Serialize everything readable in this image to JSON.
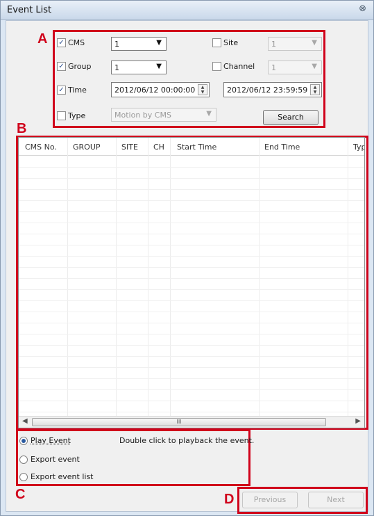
{
  "window": {
    "title": "Event List",
    "close_glyph": "⊗"
  },
  "markers": {
    "a": "A",
    "b": "B",
    "c": "C",
    "d": "D"
  },
  "filters": {
    "cms": {
      "label": "CMS",
      "checked": true,
      "value": "1"
    },
    "group": {
      "label": "Group",
      "checked": true,
      "value": "1"
    },
    "time": {
      "label": "Time",
      "checked": true,
      "start": "2012/06/12 00:00:00",
      "end": "2012/06/12 23:59:59"
    },
    "type": {
      "label": "Type",
      "checked": false,
      "value": "Motion by CMS"
    },
    "site": {
      "label": "Site",
      "checked": false,
      "value": "1"
    },
    "channel": {
      "label": "Channel",
      "checked": false,
      "value": "1"
    },
    "search_label": "Search"
  },
  "table": {
    "columns": [
      "CMS No.",
      "GROUP",
      "SITE",
      "CH",
      "Start Time",
      "End Time",
      "Typ"
    ],
    "scroll_grip": "III"
  },
  "actions": {
    "play_label": "Play Event",
    "play_hint": "Double click to playback the event.",
    "export_event_label": "Export event",
    "export_list_label": "Export event list",
    "selected": "play"
  },
  "nav": {
    "previous_label": "Previous",
    "next_label": "Next"
  },
  "icons": {
    "check": "✓",
    "dropdown": "▼",
    "spin_up": "▲",
    "spin_down": "▼",
    "scroll_left": "◀",
    "scroll_right": "▶"
  },
  "colors": {
    "annotation": "#d0021b",
    "window_frame": "#dce7f3"
  }
}
